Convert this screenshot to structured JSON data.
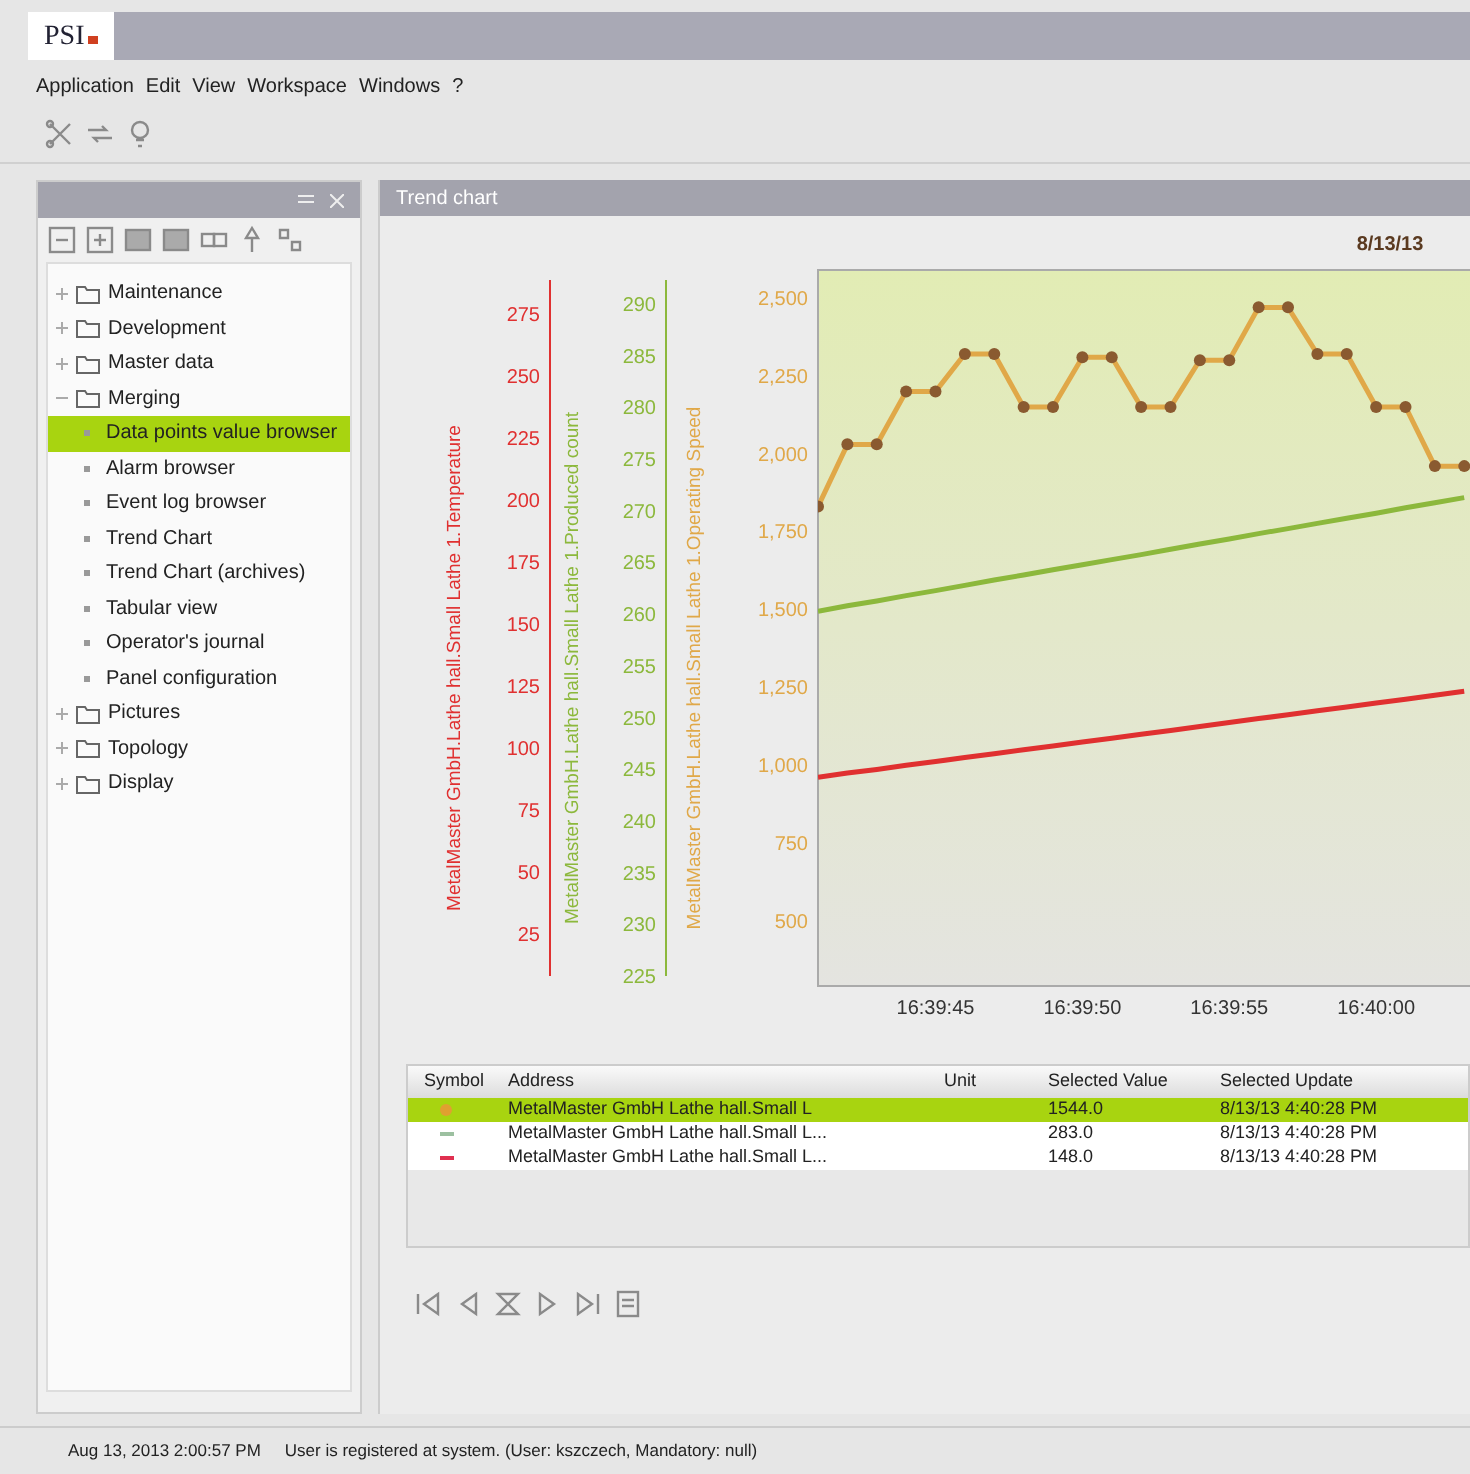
{
  "window": {
    "logo": "PSI"
  },
  "menu": [
    "Application",
    "Edit",
    "View",
    "Workspace",
    "Windows",
    "?"
  ],
  "tree": [
    {
      "label": "Maintenance",
      "expanded": false,
      "selected": false
    },
    {
      "label": "Development",
      "expanded": false,
      "selected": false
    },
    {
      "label": "Master data",
      "expanded": false,
      "selected": false
    },
    {
      "label": "Merging",
      "expanded": true,
      "selected": false,
      "children": [
        {
          "label": "Data points value browser",
          "selected": true
        },
        {
          "label": "Alarm browser",
          "selected": false
        },
        {
          "label": "Event log browser",
          "selected": false
        },
        {
          "label": "Trend Chart",
          "selected": false
        },
        {
          "label": "Trend Chart (archives)",
          "selected": false
        },
        {
          "label": "Tabular view",
          "selected": false
        },
        {
          "label": "Operator's journal",
          "selected": false
        },
        {
          "label": "Panel configuration",
          "selected": false
        }
      ]
    },
    {
      "label": "Pictures",
      "expanded": false,
      "selected": false
    },
    {
      "label": "Topology",
      "expanded": false,
      "selected": false
    },
    {
      "label": "Display",
      "expanded": false,
      "selected": false
    }
  ],
  "panel": {
    "title": "Trend chart",
    "date": "8/13/13",
    "left_axes": [
      {
        "ticks": [
          "275",
          "250",
          "225",
          "200",
          "175",
          "150",
          "125",
          "100",
          "75",
          "50",
          "25"
        ]
      },
      {
        "ticks": [
          "290",
          "285",
          "280",
          "275",
          "270",
          "265",
          "260",
          "255",
          "250",
          "245",
          "240",
          "235",
          "230",
          "225"
        ]
      }
    ],
    "chart_data": {
      "type": "line",
      "categories": [
        null,
        null,
        null,
        null,
        "16:39:45",
        null,
        null,
        null,
        null,
        "16:39:50",
        null,
        null,
        null,
        null,
        "16:39:55",
        null,
        null,
        null,
        null,
        "16:40:00",
        null,
        null,
        null
      ],
      "ylim": [
        290,
        2590
      ],
      "yticks": [
        {
          "value": 500,
          "label": "500"
        },
        {
          "value": 750,
          "label": "750"
        },
        {
          "value": 1000,
          "label": "1,000"
        },
        {
          "value": 1250,
          "label": "1,250"
        },
        {
          "value": 1500,
          "label": "1,500"
        },
        {
          "value": 1750,
          "label": "1,750"
        },
        {
          "value": 2000,
          "label": "2,000"
        },
        {
          "value": 2250,
          "label": "2,250"
        },
        {
          "value": 2500,
          "label": "2,500"
        }
      ],
      "series": [
        {
          "name": "MetalMaster GmbH.Lathe hall.Small Lathe 1.Temperature",
          "color": "#e03030",
          "values": [
            961,
            974,
            986,
            999,
            1011,
            1024,
            1036,
            1049,
            1061,
            1074,
            1086,
            1099,
            1111,
            1124,
            1136,
            1149,
            1161,
            1174,
            1186,
            1199,
            1211,
            1224,
            1237
          ]
        },
        {
          "name": "MetalMaster GmbH.Lathe hall.Small Lathe 1.Produced count",
          "color": "#8cb83c",
          "values": [
            1494,
            1511,
            1527,
            1544,
            1560,
            1577,
            1594,
            1610,
            1627,
            1643,
            1660,
            1676,
            1693,
            1710,
            1726,
            1743,
            1759,
            1776,
            1793,
            1809,
            1826,
            1842,
            1859
          ]
        },
        {
          "name": "MetalMaster GmbH.Lathe hall.Small Lathe 1.Operating Speed",
          "color": "#e0a848",
          "marker": "circle",
          "values": [
            1830,
            2030,
            2030,
            2200,
            2200,
            2320,
            2320,
            2150,
            2150,
            2310,
            2310,
            2150,
            2150,
            2300,
            2300,
            2470,
            2470,
            2320,
            2320,
            2150,
            2150,
            1960,
            1960
          ]
        }
      ]
    }
  },
  "table": {
    "columns": [
      "Symbol",
      "Address",
      "Unit",
      "Selected Value",
      "Selected Update"
    ],
    "rows": [
      {
        "kind": "dot",
        "color": "#e0a030",
        "address": "MetalMaster GmbH Lathe hall.Small L",
        "value": "1544.0",
        "update": "8/13/13 4:40:28 PM",
        "selected": true
      },
      {
        "kind": "dash",
        "color": "#9cc0a0",
        "address": "MetalMaster GmbH Lathe hall.Small L...",
        "value": "283.0",
        "update": "8/13/13 4:40:28 PM",
        "selected": false
      },
      {
        "kind": "dash",
        "color": "#e03050",
        "address": "MetalMaster GmbH Lathe hall.Small L...",
        "value": "148.0",
        "update": "8/13/13 4:40:28 PM",
        "selected": false
      }
    ]
  },
  "status_bar": {
    "time": "Aug 13, 2013 2:00:57 PM",
    "message": "User is registered at system. (User: kszczech, Mandatory: null)"
  }
}
